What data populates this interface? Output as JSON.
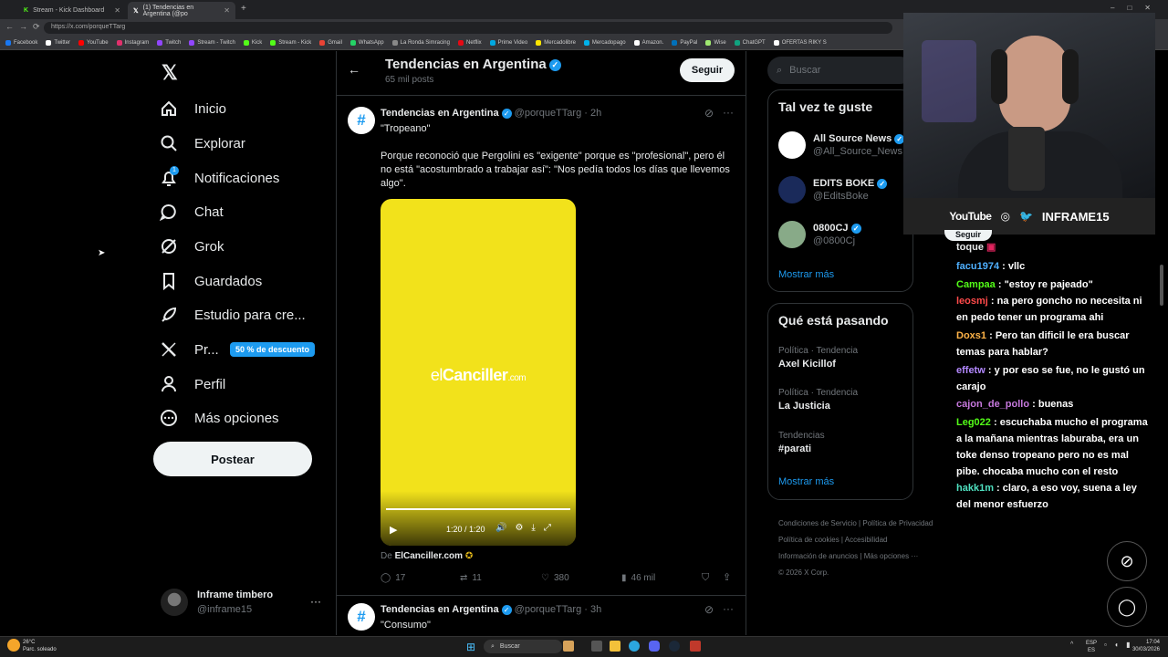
{
  "browser": {
    "tabs": [
      {
        "label": "Stream - Kick Dashboard",
        "active": false
      },
      {
        "label": "(1) Tendencias en Argentina (@po",
        "active": true
      }
    ],
    "url": "https://x.com/porqueTTarg",
    "bookmarks": [
      "Facebook",
      "Twitter",
      "YouTube",
      "Instagram",
      "Twitch",
      "Stream - Twitch",
      "Kick",
      "Stream - Kick",
      "Gmail",
      "WhatsApp",
      "La Ronda Simracing",
      "Netflix",
      "Prime Video",
      "Mercadolibre",
      "Mercadopago",
      "Amazon.",
      "PayPal",
      "Wise",
      "ChatGPT",
      "OFERTAS RIKY S"
    ]
  },
  "nav": {
    "items": [
      {
        "label": "Inicio",
        "icon": "home-icon"
      },
      {
        "label": "Explorar",
        "icon": "search-icon"
      },
      {
        "label": "Notificaciones",
        "icon": "bell-icon",
        "badge": "1"
      },
      {
        "label": "Chat",
        "icon": "chat-icon"
      },
      {
        "label": "Grok",
        "icon": "grok-icon"
      },
      {
        "label": "Guardados",
        "icon": "bookmark-icon"
      },
      {
        "label": "Estudio para cre...",
        "icon": "rocket-icon"
      },
      {
        "label": "Pr...",
        "icon": "x-logo-icon",
        "promo": "50 % de descuento"
      },
      {
        "label": "Perfil",
        "icon": "person-icon"
      },
      {
        "label": "Más opciones",
        "icon": "more-circle-icon"
      }
    ],
    "post_label": "Postear",
    "account": {
      "name": "Inframe timbero",
      "handle": "@inframe15"
    }
  },
  "profile_header": {
    "title": "Tendencias en Argentina",
    "posts_count": "65 mil posts",
    "follow_label": "Seguir"
  },
  "tweets": [
    {
      "name": "Tendencias en Argentina",
      "handle": "@porqueTTarg",
      "time": "2h",
      "headline": "\"Tropeano\"",
      "body": "Porque reconoció que Pergolini es \"exigente\" porque es \"profesional\", pero él no está \"acostumbrado a trabajar así\": \"Nos pedía todos los días que llevemos algo\".",
      "media": {
        "brand_prefix": "el",
        "brand_main": "Canciller",
        "brand_suffix": ".com",
        "time": "1:20 / 1:20",
        "progress": 1.0,
        "bg_color": "#f2e21b"
      },
      "source_prefix": "De",
      "source": "ElCanciller.com",
      "stats": {
        "replies": "17",
        "reposts": "11",
        "likes": "380",
        "views": "46 mil"
      }
    },
    {
      "name": "Tendencias en Argentina",
      "handle": "@porqueTTarg",
      "time": "3h",
      "headline": "\"Consumo\""
    }
  ],
  "right": {
    "search_placeholder": "Buscar",
    "suggestions_title": "Tal vez te guste",
    "suggestions": [
      {
        "name": "All Source News",
        "handle": "@All_Source_News"
      },
      {
        "name": "EDITS BOKE",
        "handle": "@EditsBoke"
      },
      {
        "name": "0800CJ",
        "handle": "@0800Cj"
      }
    ],
    "show_more": "Mostrar más",
    "trends_title": "Qué está pasando",
    "trends": [
      {
        "category": "Política · Tendencia",
        "name": "Axel Kicillof"
      },
      {
        "category": "Política · Tendencia",
        "name": "La Justicia"
      },
      {
        "category": "Tendencias",
        "name": "#parati"
      }
    ],
    "trends_more": "Mostrar más",
    "footer": [
      "Condiciones de Servicio",
      "Política de Privacidad",
      "Política de cookies",
      "Accesibilidad",
      "Información de anuncios",
      "Más opciones ···",
      "© 2026 X Corp."
    ]
  },
  "stream_overlay": {
    "socials": [
      "YouTube",
      "INFRAME15"
    ],
    "partial_button": "Seguir",
    "partial_text": "toque",
    "chat": [
      {
        "user": "facu1974",
        "text": ": vllc",
        "color": "#4fb0ff"
      },
      {
        "user": "Campaa",
        "text": ": \"estoy re pajeado\"",
        "color": "#53fc18"
      },
      {
        "user": "leosmj",
        "text": ": na pero goncho no necesita ni en pedo tener un programa ahi",
        "color": "#ff4a4a"
      },
      {
        "user": "Doxs1",
        "text": ": Pero tan dificil le era buscar temas para hablar?",
        "color": "#ffb347"
      },
      {
        "user": "effetw",
        "text": ": y por eso se fue, no le gustó un carajo",
        "color": "#b388ff"
      },
      {
        "user": "cajon_de_pollo",
        "text": ": buenas",
        "color": "#c678dd"
      },
      {
        "user": "Leg022",
        "text": ": escuchaba mucho el programa a la mañana mientras laburaba, era un toke denso tropeano pero no es mal pibe. chocaba mucho con el resto",
        "color": "#53fc18"
      },
      {
        "user": "hakk1m",
        "text": ": claro, a eso voy, suena a ley del menor esfuerzo",
        "color": "#4fe0c0"
      }
    ]
  },
  "taskbar": {
    "weather_temp": "26°C",
    "weather_desc": "Parc. soleado",
    "search_label": "Buscar",
    "lang": "ESP",
    "lang_sub": "ES",
    "time": "17:04",
    "date": "30/03/2026"
  }
}
